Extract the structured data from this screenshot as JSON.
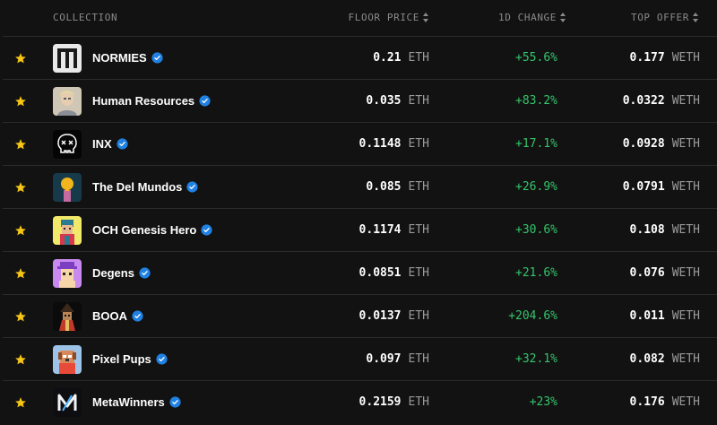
{
  "header": {
    "collection": "COLLECTION",
    "floor_price": "FLOOR PRICE",
    "change_1d": "1D CHANGE",
    "top_offer": "TOP OFFER"
  },
  "colors": {
    "accent_star": "#f5c518",
    "change_positive": "#34c56b",
    "verified": "#2081e2",
    "background": "#121212"
  },
  "rows": [
    {
      "name": "NORMIES",
      "floor": "0.21",
      "floor_unit": "ETH",
      "change": "+55.6%",
      "offer": "0.177",
      "offer_unit": "WETH",
      "thumb": "normies-logo"
    },
    {
      "name": "Human Resources",
      "floor": "0.035",
      "floor_unit": "ETH",
      "change": "+83.2%",
      "offer": "0.0322",
      "offer_unit": "WETH",
      "thumb": "human-resources-avatar"
    },
    {
      "name": "INX",
      "floor": "0.1148",
      "floor_unit": "ETH",
      "change": "+17.1%",
      "offer": "0.0928",
      "offer_unit": "WETH",
      "thumb": "inx-skull"
    },
    {
      "name": "The Del Mundos",
      "floor": "0.085",
      "floor_unit": "ETH",
      "change": "+26.9%",
      "offer": "0.0791",
      "offer_unit": "WETH",
      "thumb": "del-mundos-avatar"
    },
    {
      "name": "OCH Genesis Hero",
      "floor": "0.1174",
      "floor_unit": "ETH",
      "change": "+30.6%",
      "offer": "0.108",
      "offer_unit": "WETH",
      "thumb": "och-hero-avatar"
    },
    {
      "name": "Degens",
      "floor": "0.0851",
      "floor_unit": "ETH",
      "change": "+21.6%",
      "offer": "0.076",
      "offer_unit": "WETH",
      "thumb": "degens-avatar"
    },
    {
      "name": "BOOA",
      "floor": "0.0137",
      "floor_unit": "ETH",
      "change": "+204.6%",
      "offer": "0.011",
      "offer_unit": "WETH",
      "thumb": "booa-avatar"
    },
    {
      "name": "Pixel Pups",
      "floor": "0.097",
      "floor_unit": "ETH",
      "change": "+32.1%",
      "offer": "0.082",
      "offer_unit": "WETH",
      "thumb": "pixel-pups-avatar"
    },
    {
      "name": "MetaWinners",
      "floor": "0.2159",
      "floor_unit": "ETH",
      "change": "+23%",
      "offer": "0.176",
      "offer_unit": "WETH",
      "thumb": "metawinners-logo"
    }
  ]
}
